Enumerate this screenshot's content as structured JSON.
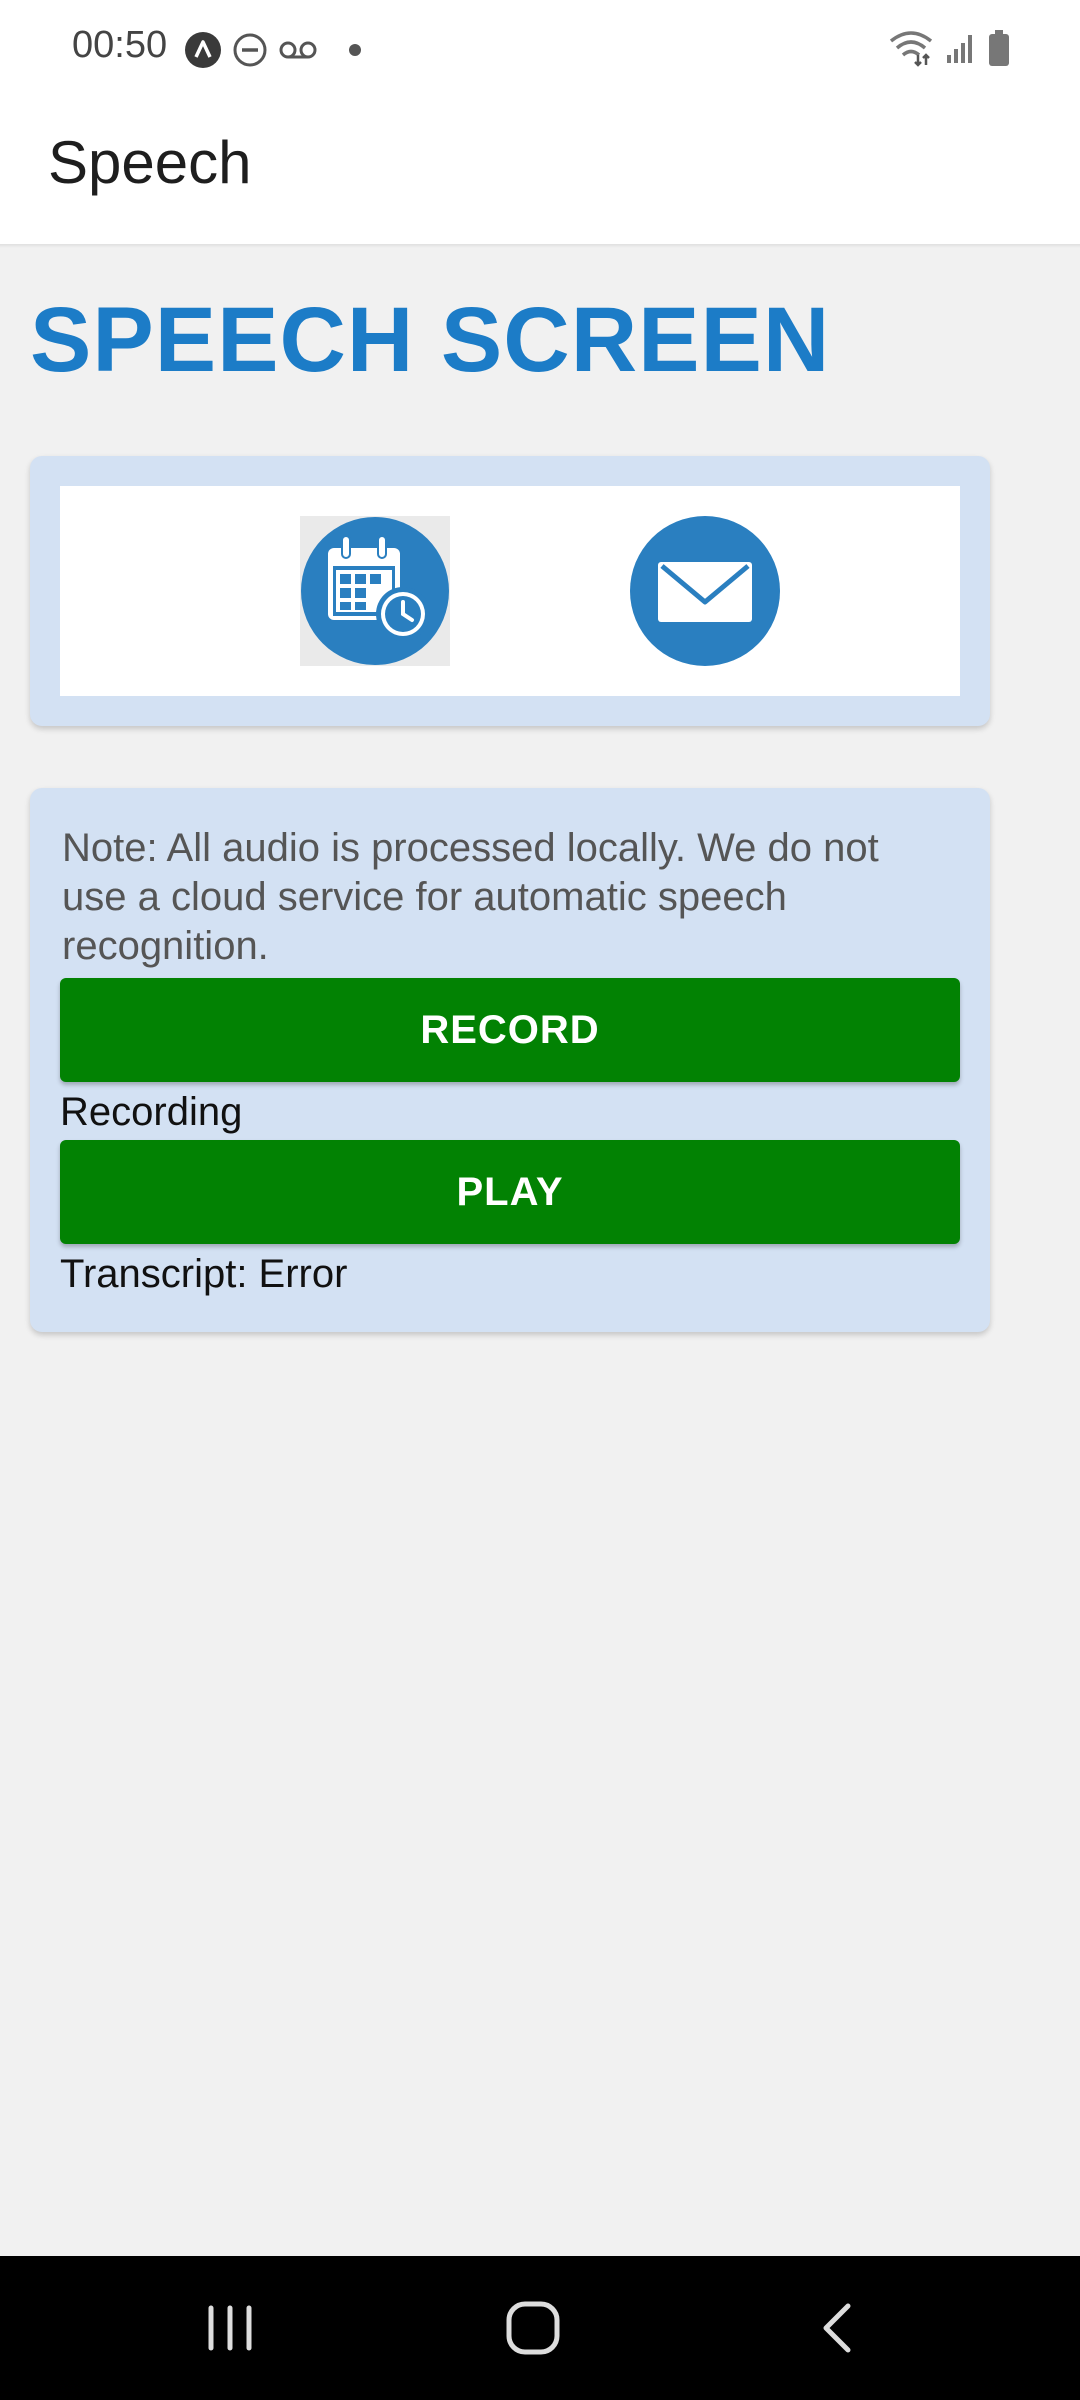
{
  "status_bar": {
    "time": "00:50",
    "left_icons": [
      "android-assistant-icon",
      "do-not-disturb-icon",
      "voicemail-icon",
      "notification-dot-icon"
    ],
    "right_icons": [
      "wifi-icon",
      "cell-signal-icon",
      "battery-icon"
    ]
  },
  "app_bar": {
    "title": "Speech"
  },
  "screen": {
    "title": "SPEECH SCREEN"
  },
  "shortcuts": [
    {
      "name": "calendar-clock-icon"
    },
    {
      "name": "mail-icon"
    }
  ],
  "speech_card": {
    "note": "Note: All audio is processed locally. We do not use a cloud service for automatic speech recognition.",
    "record_label": "RECORD",
    "recording_status": "Recording",
    "play_label": "PLAY",
    "transcript": "Transcript: Error"
  },
  "nav_bar": {
    "buttons": [
      "recents-icon",
      "home-icon",
      "back-icon"
    ]
  },
  "colors": {
    "title_blue": "#1c7cc7",
    "card_bg": "#d3e1f3",
    "button_green": "#028203",
    "icon_blue": "#2a7fc0"
  }
}
